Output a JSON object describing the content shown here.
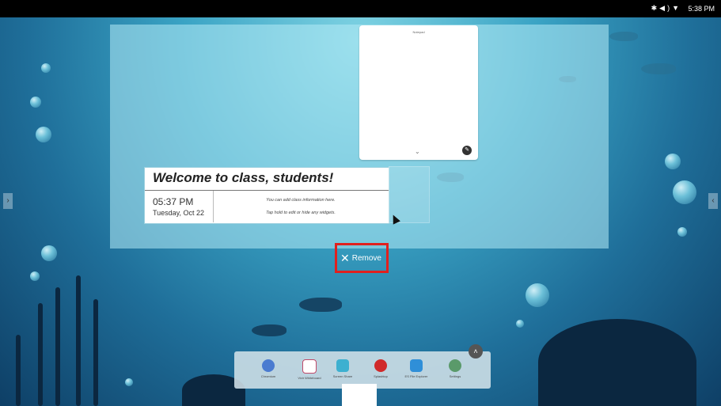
{
  "status_bar": {
    "time": "5:38 PM",
    "icons": [
      "bluetooth-icon",
      "volume-icon",
      "wifi-icon"
    ]
  },
  "notepad": {
    "title": "Notepad"
  },
  "welcome_widget": {
    "title": "Welcome to class, students!",
    "time": "05:37 PM",
    "date": "Tuesday, Oct 22",
    "info_line1": "You can add class information here.",
    "info_line2": "Tap hold to edit or hide any widgets."
  },
  "remove_button": {
    "label": "Remove",
    "highlight_color": "#e0201e"
  },
  "dock": {
    "items": [
      {
        "label": "Chromium",
        "icon": "chromium-icon",
        "color": "#4a7bd0"
      },
      {
        "label": "Vivir Whiteboard",
        "icon": "whiteboard-icon",
        "color": "#c04a6a"
      },
      {
        "label": "Screen Share",
        "icon": "screen-share-icon",
        "color": "#3db0d0"
      },
      {
        "label": "Splashtop",
        "icon": "splashtop-icon",
        "color": "#d02a2a"
      },
      {
        "label": "ES File Explorer",
        "icon": "file-explorer-icon",
        "color": "#2f8fd8"
      },
      {
        "label": "Settings",
        "icon": "settings-icon",
        "color": "#5a9a6a"
      }
    ]
  }
}
